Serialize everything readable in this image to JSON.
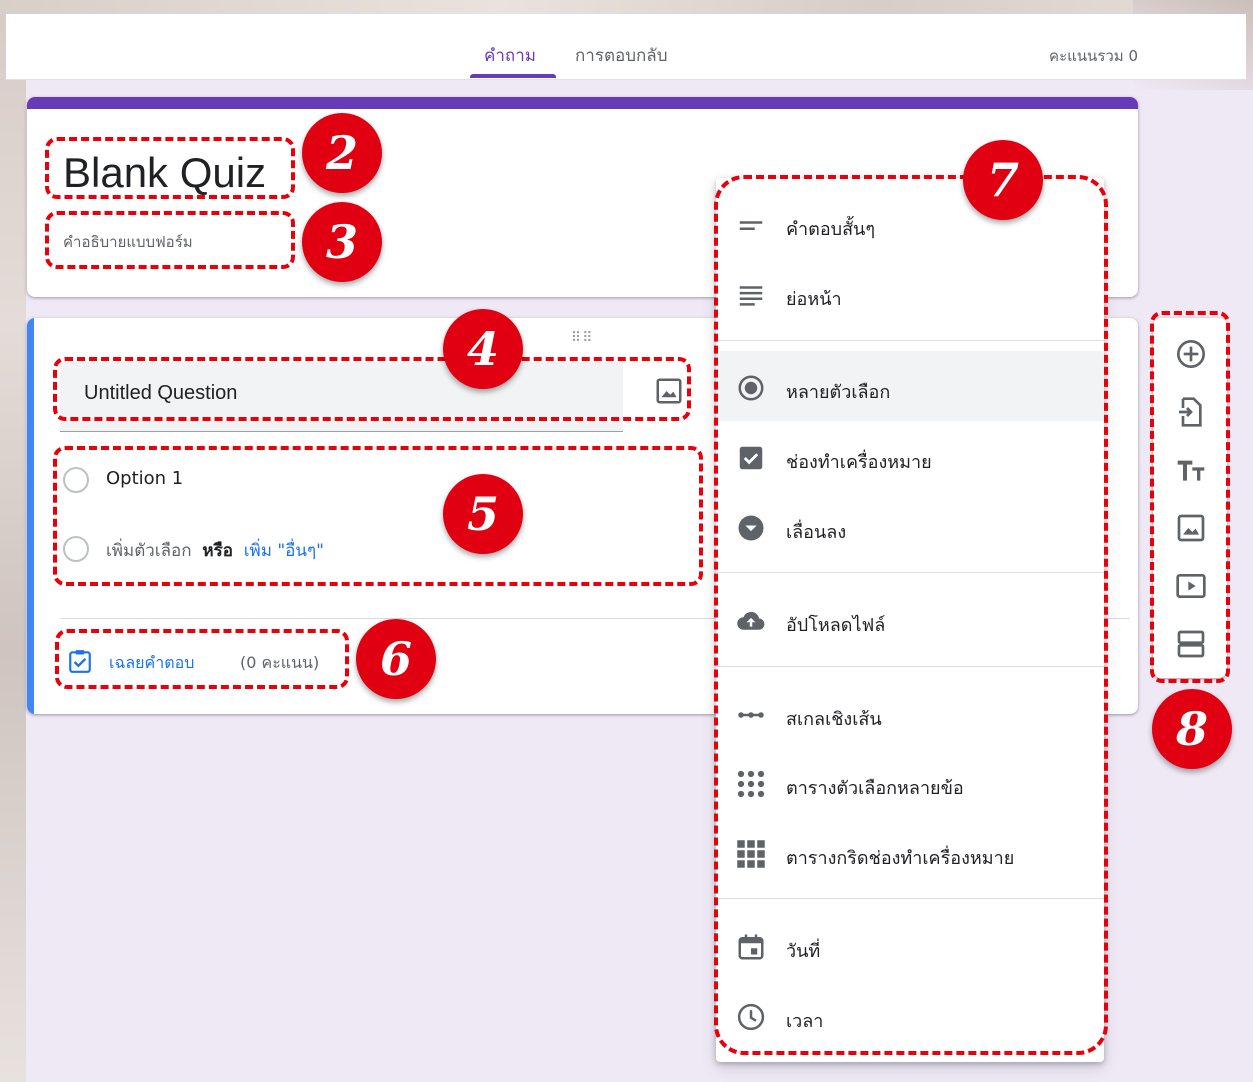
{
  "header": {
    "tabs": [
      {
        "label": "คำถาม",
        "active": true
      },
      {
        "label": "การตอบกลับ",
        "active": false
      }
    ],
    "total_score": "คะแนนรวม 0"
  },
  "form": {
    "title": "Blank Quiz",
    "description_placeholder": "คำอธิบายแบบฟอร์ม",
    "accent_color": "#673ab7"
  },
  "question": {
    "title": "Untitled Question",
    "options": [
      "Option 1"
    ],
    "add_option": "เพิ่มตัวเลือก",
    "or": "หรือ",
    "add_other": "เพิ่ม \"อื่นๆ\"",
    "answer_key": "เฉลยคำตอบ",
    "points": "(0 คะแนน)",
    "accent_color": "#4285f4"
  },
  "type_menu": {
    "items": [
      {
        "label": "คำตอบสั้นๆ",
        "icon": "short-answer-icon"
      },
      {
        "label": "ย่อหน้า",
        "icon": "paragraph-icon"
      },
      {
        "label": "หลายตัวเลือก",
        "icon": "radio-button-icon",
        "selected": true
      },
      {
        "label": "ช่องทำเครื่องหมาย",
        "icon": "checkbox-icon"
      },
      {
        "label": "เลื่อนลง",
        "icon": "dropdown-icon"
      },
      {
        "label": "อัปโหลดไฟล์",
        "icon": "cloud-upload-icon"
      },
      {
        "label": "สเกลเชิงเส้น",
        "icon": "linear-scale-icon"
      },
      {
        "label": "ตารางตัวเลือกหลายข้อ",
        "icon": "multiple-choice-grid-icon"
      },
      {
        "label": "ตารางกริดช่องทำเครื่องหมาย",
        "icon": "checkbox-grid-icon"
      },
      {
        "label": "วันที่",
        "icon": "calendar-icon"
      },
      {
        "label": "เวลา",
        "icon": "clock-icon"
      }
    ]
  },
  "side_toolbar": {
    "icons": [
      "add-question-icon",
      "import-questions-icon",
      "add-title-icon",
      "add-image-icon",
      "add-video-icon",
      "add-section-icon"
    ]
  },
  "annotations": {
    "badges": [
      "2",
      "3",
      "4",
      "5",
      "6",
      "7",
      "8"
    ],
    "color": "#e00012"
  }
}
